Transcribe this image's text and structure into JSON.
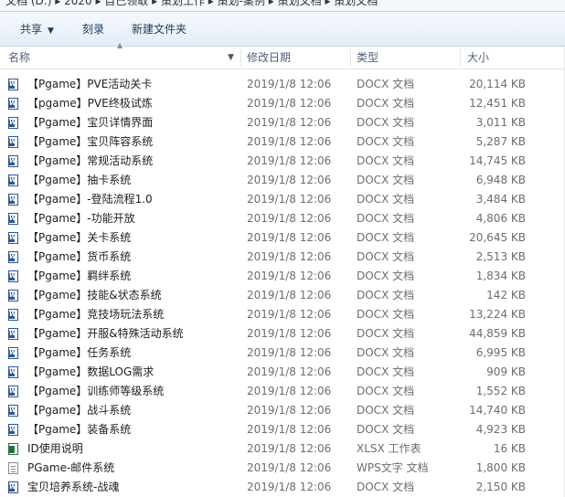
{
  "address": {
    "text": "文档 (D:) ▸ 2020 ▸ 自己领取 ▸ 策划工作 ▸ 策划-案例 ▸ 策划文档 ▸ 策划文档"
  },
  "toolbar": {
    "share_label": "共享",
    "burn_label": "刻录",
    "new_folder_label": "新建文件夹"
  },
  "columns": {
    "name": "名称",
    "date": "修改日期",
    "type": "类型",
    "size": "大小"
  },
  "files": [
    {
      "icon": "docx-icon",
      "name": "【Pgame】PVE活动关卡",
      "date": "2019/1/8 12:06",
      "type": "DOCX 文档",
      "size": "20,114 KB"
    },
    {
      "icon": "docx-icon",
      "name": "【pgame】PVE终极试炼",
      "date": "2019/1/8 12:06",
      "type": "DOCX 文档",
      "size": "12,451 KB"
    },
    {
      "icon": "docx-icon",
      "name": "【Pgame】宝贝详情界面",
      "date": "2019/1/8 12:06",
      "type": "DOCX 文档",
      "size": "3,011 KB"
    },
    {
      "icon": "docx-icon",
      "name": "【Pgame】宝贝阵容系统",
      "date": "2019/1/8 12:06",
      "type": "DOCX 文档",
      "size": "5,287 KB"
    },
    {
      "icon": "docx-icon",
      "name": "【Pgame】常规活动系统",
      "date": "2019/1/8 12:06",
      "type": "DOCX 文档",
      "size": "14,745 KB"
    },
    {
      "icon": "docx-icon",
      "name": "【Pgame】抽卡系统",
      "date": "2019/1/8 12:06",
      "type": "DOCX 文档",
      "size": "6,948 KB"
    },
    {
      "icon": "docx-icon",
      "name": "【Pgame】-登陆流程1.0",
      "date": "2019/1/8 12:06",
      "type": "DOCX 文档",
      "size": "3,484 KB"
    },
    {
      "icon": "docx-icon",
      "name": "【Pgame】-功能开放",
      "date": "2019/1/8 12:06",
      "type": "DOCX 文档",
      "size": "4,806 KB"
    },
    {
      "icon": "docx-icon",
      "name": "【Pgame】关卡系统",
      "date": "2019/1/8 12:06",
      "type": "DOCX 文档",
      "size": "20,645 KB"
    },
    {
      "icon": "docx-icon",
      "name": "【Pgame】货币系统",
      "date": "2019/1/8 12:06",
      "type": "DOCX 文档",
      "size": "2,513 KB"
    },
    {
      "icon": "docx-icon",
      "name": "【Pgame】羁绊系统",
      "date": "2019/1/8 12:06",
      "type": "DOCX 文档",
      "size": "1,834 KB"
    },
    {
      "icon": "docx-icon",
      "name": "【Pgame】技能&状态系统",
      "date": "2019/1/8 12:06",
      "type": "DOCX 文档",
      "size": "142 KB"
    },
    {
      "icon": "docx-icon",
      "name": "【Pgame】竞技场玩法系统",
      "date": "2019/1/8 12:06",
      "type": "DOCX 文档",
      "size": "13,224 KB"
    },
    {
      "icon": "docx-icon",
      "name": "【Pgame】开服&特殊活动系统",
      "date": "2019/1/8 12:06",
      "type": "DOCX 文档",
      "size": "44,859 KB"
    },
    {
      "icon": "docx-icon",
      "name": "【Pgame】任务系统",
      "date": "2019/1/8 12:06",
      "type": "DOCX 文档",
      "size": "6,995 KB"
    },
    {
      "icon": "docx-icon",
      "name": "【Pgame】数据LOG需求",
      "date": "2019/1/8 12:06",
      "type": "DOCX 文档",
      "size": "909 KB"
    },
    {
      "icon": "docx-icon",
      "name": "【Pgame】训练师等级系统",
      "date": "2019/1/8 12:06",
      "type": "DOCX 文档",
      "size": "1,552 KB"
    },
    {
      "icon": "docx-icon",
      "name": "【Pgame】战斗系统",
      "date": "2019/1/8 12:06",
      "type": "DOCX 文档",
      "size": "14,740 KB"
    },
    {
      "icon": "docx-icon",
      "name": "【Pgame】装备系统",
      "date": "2019/1/8 12:06",
      "type": "DOCX 文档",
      "size": "4,923 KB"
    },
    {
      "icon": "xlsx-icon",
      "name": "ID使用说明",
      "date": "2019/1/8 12:06",
      "type": "XLSX 工作表",
      "size": "16 KB"
    },
    {
      "icon": "wps-icon",
      "name": "PGame-邮件系统",
      "date": "2019/1/8 12:06",
      "type": "WPS文字 文档",
      "size": "1,800 KB"
    },
    {
      "icon": "docx-icon",
      "name": "宝贝培养系统-战魂",
      "date": "2019/1/8 12:06",
      "type": "DOCX 文档",
      "size": "2,150 KB"
    }
  ]
}
